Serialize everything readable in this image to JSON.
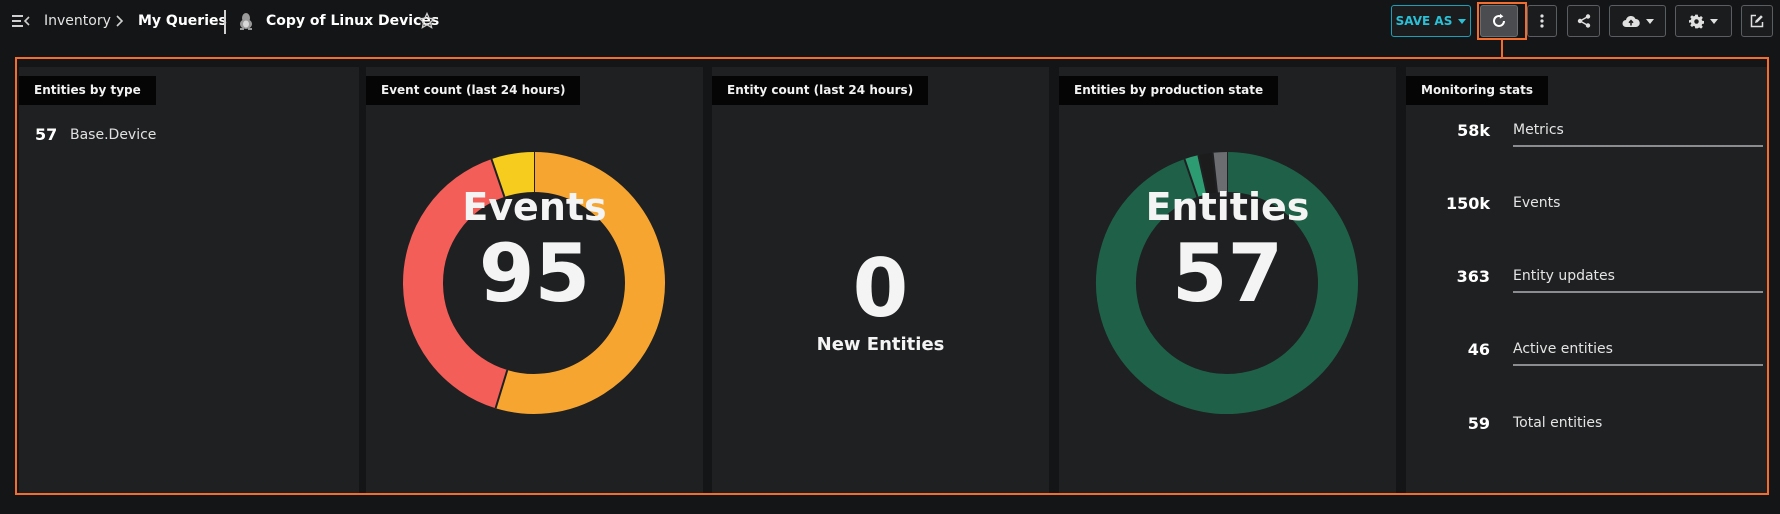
{
  "breadcrumb": {
    "root": "Inventory",
    "section": "My Queries",
    "title": "Copy of Linux Devices"
  },
  "toolbar": {
    "save_as_label": "SAVE AS",
    "accent_color": "#2bc0d6",
    "highlight_color": "#f26d2e",
    "icons": [
      "menu-icon",
      "chevron-right-icon",
      "linux-icon",
      "star-icon",
      "caret-down-icon",
      "refresh-icon",
      "more-vertical-icon",
      "share-icon",
      "cloud-upload-icon",
      "gear-icon",
      "edit-icon"
    ]
  },
  "panels": {
    "entities_by_type": {
      "title": "Entities by type",
      "items": [
        {
          "count": "57",
          "label": "Base.Device"
        }
      ]
    },
    "event_count": {
      "title": "Event count (last 24 hours)",
      "center_label": "Events",
      "center_value": "95"
    },
    "entity_count": {
      "title": "Entity count (last 24 hours)",
      "value": "0",
      "label": "New Entities"
    },
    "production_state": {
      "title": "Entities by production state",
      "center_label": "Entities",
      "center_value": "57"
    },
    "monitoring_stats": {
      "title": "Monitoring stats",
      "stats": [
        {
          "value": "58k",
          "label": "Metrics"
        },
        {
          "value": "150k",
          "label": "Events"
        },
        {
          "value": "363",
          "label": "Entity updates"
        },
        {
          "value": "46",
          "label": "Active entities"
        },
        {
          "value": "59",
          "label": "Total entities"
        }
      ]
    }
  },
  "chart_data": [
    {
      "type": "pie",
      "chart": "event-count-donut",
      "series": [
        {
          "value": 52,
          "color": "#f7a531"
        },
        {
          "value": 38,
          "color": "#f35e58"
        },
        {
          "value": 5,
          "color": "#f6cd1e"
        }
      ]
    },
    {
      "type": "pie",
      "chart": "production-state-donut",
      "series": [
        {
          "value": 54,
          "color": "#1e6148"
        },
        {
          "value": 1,
          "color": "#2e9c72"
        },
        {
          "value": 1,
          "color": "#1c1c1c"
        },
        {
          "value": 1,
          "color": "#6b6d70"
        }
      ]
    }
  ]
}
